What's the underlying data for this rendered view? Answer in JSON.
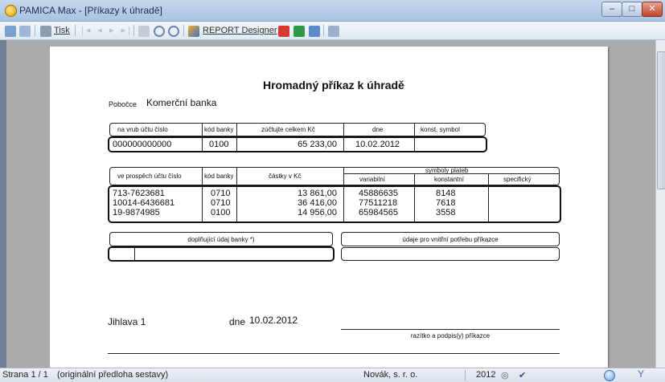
{
  "window": {
    "title": "PAMICA Max - [Příkazy k úhradě]",
    "minimize": "–",
    "maximize": "□",
    "close": "✕"
  },
  "toolbar": {
    "print_label": "Tisk",
    "report_designer_label": "REPORT Designer"
  },
  "doc": {
    "title": "Hromadný příkaz k úhradě",
    "branch_label": "Pobočce",
    "branch_value": "Komerční banka",
    "debit_table": {
      "headers": [
        "na vrub účtu číslo",
        "kód banky",
        "zúčtujte celkem Kč",
        "dne",
        "konst. symbol"
      ],
      "row": [
        "000000000000",
        "0100",
        "65 233,00",
        "10.02.2012",
        ""
      ]
    },
    "credit_table": {
      "headers": {
        "account": "ve prospěch účtu číslo",
        "bank": "kód banky",
        "amount": "částky v Kč",
        "symbols": "symboly plateb",
        "variable": "variabilní",
        "constant": "konstantní",
        "specific": "specifický"
      },
      "rows": [
        {
          "account": "713-7623681",
          "bank": "0710",
          "amount": "13 861,00",
          "variable": "45886635",
          "constant": "8148",
          "specific": ""
        },
        {
          "account": "10014-6436681",
          "bank": "0710",
          "amount": "36 416,00",
          "variable": "77511218",
          "constant": "7618",
          "specific": ""
        },
        {
          "account": "19-9874985",
          "bank": "0100",
          "amount": "14 956,00",
          "variable": "65984565",
          "constant": "3558",
          "specific": ""
        }
      ]
    },
    "bank_info_label": "doplňující údaj banky *)",
    "internal_label": "údaje pro vnitřní potřebu příkazce",
    "place": "Jihlava 1",
    "date_label": "dne",
    "date_value": "10.02.2012",
    "signature_label": "razítko a podpis(y) příkazce"
  },
  "status": {
    "page": "Strana 1 / 1",
    "template": "(originální předloha sestavy)",
    "company": "Novák, s. r. o.",
    "year": "2012"
  },
  "colors": {
    "titlebar": "#b8cde8",
    "workspace": "#ababab",
    "page": "#ffffff",
    "accent": "#1b3f8c"
  }
}
